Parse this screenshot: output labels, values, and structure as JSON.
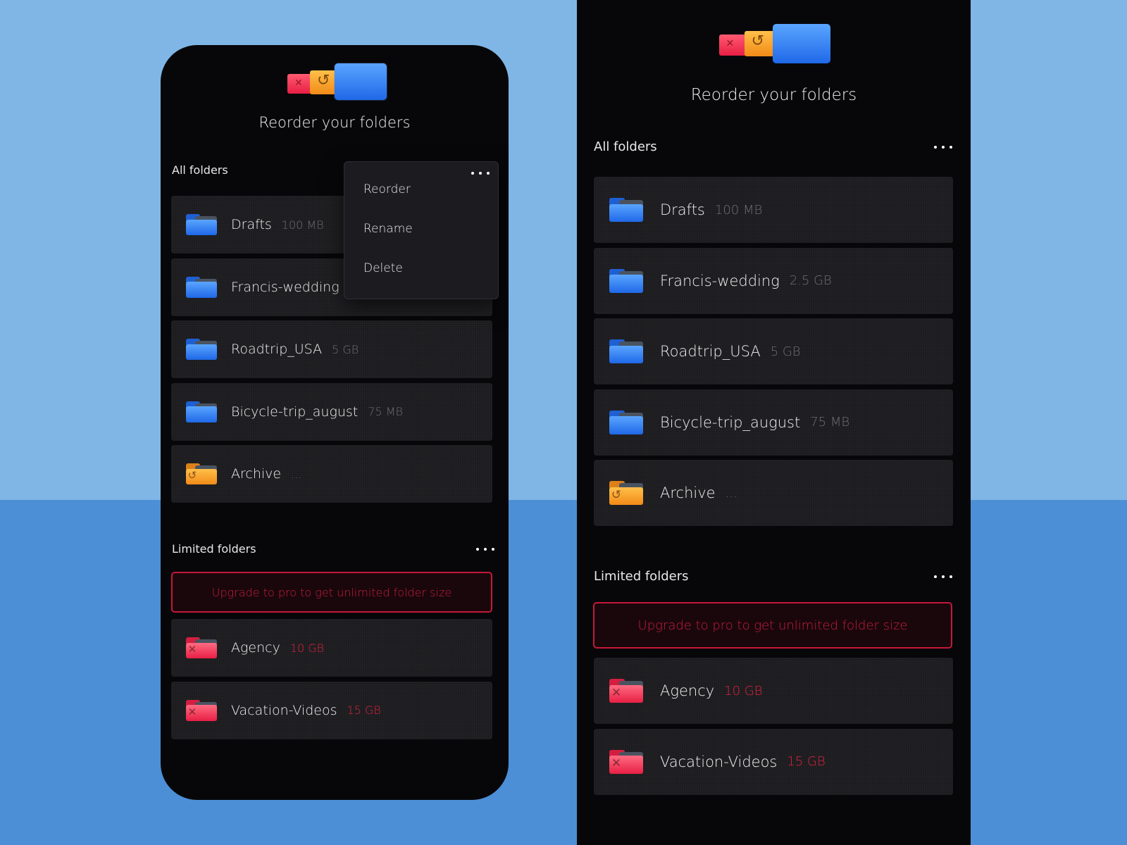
{
  "screen": {
    "title": "Reorder your folders",
    "all_folders_label": "All folders",
    "limited_folders_label": "Limited folders",
    "upgrade_banner": "Upgrade to pro to get unlimited folder size",
    "menu": {
      "items": [
        "Reorder",
        "Rename",
        "Delete"
      ]
    },
    "all_folders": [
      {
        "name": "Drafts",
        "size": "100 MB",
        "icon": "blue-folder-icon"
      },
      {
        "name": "Francis-wedding",
        "size": "2.5 GB",
        "icon": "blue-folder-icon"
      },
      {
        "name": "Roadtrip_USA",
        "size": "5 GB",
        "icon": "blue-folder-icon"
      },
      {
        "name": "Bicycle-trip_august",
        "size": "75 MB",
        "icon": "blue-folder-icon"
      },
      {
        "name": "Archive",
        "size": "...",
        "icon": "archive-folder-icon"
      }
    ],
    "limited_folders": [
      {
        "name": "Agency",
        "size": "10 GB",
        "icon": "locked-folder-icon"
      },
      {
        "name": "Vacation-Videos",
        "size": "15 GB",
        "icon": "locked-folder-icon"
      }
    ]
  },
  "colors": {
    "blue_folder": "#2f7df0",
    "orange_folder": "#f6a12a",
    "red_folder": "#f2354f",
    "warning": "#e0213f",
    "background_light": "#7fb6e6",
    "background_dark": "#4c8fd6"
  }
}
